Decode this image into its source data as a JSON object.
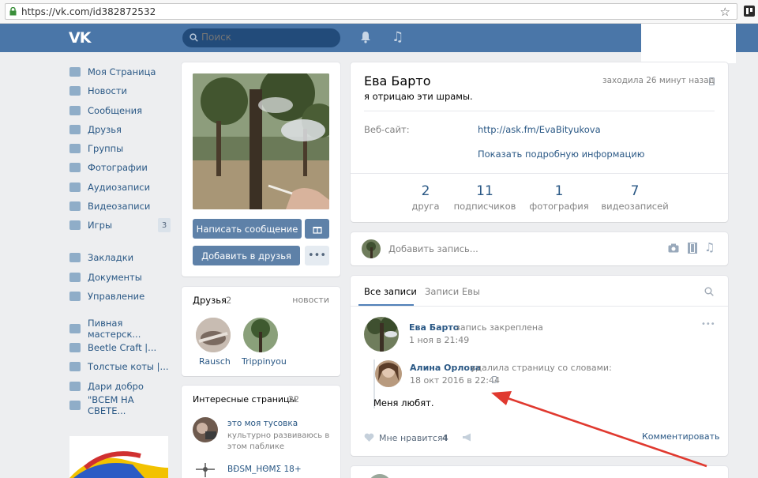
{
  "browser": {
    "url": "https://vk.com/id382872532"
  },
  "header": {
    "search_placeholder": "Поиск"
  },
  "menu": {
    "items": [
      {
        "label": "Моя Страница",
        "icon": "home-icon"
      },
      {
        "label": "Новости",
        "icon": "news-icon"
      },
      {
        "label": "Сообщения",
        "icon": "messages-icon"
      },
      {
        "label": "Друзья",
        "icon": "friends-icon"
      },
      {
        "label": "Группы",
        "icon": "groups-icon"
      },
      {
        "label": "Фотографии",
        "icon": "photos-icon"
      },
      {
        "label": "Аудиозаписи",
        "icon": "audio-icon"
      },
      {
        "label": "Видеозаписи",
        "icon": "video-icon"
      },
      {
        "label": "Игры",
        "icon": "games-icon",
        "badge": "3"
      }
    ],
    "items2": [
      {
        "label": "Закладки",
        "icon": "bookmarks-icon"
      },
      {
        "label": "Документы",
        "icon": "documents-icon"
      },
      {
        "label": "Управление",
        "icon": "manage-icon"
      }
    ],
    "communities": [
      {
        "label": "Пивная мастерск..."
      },
      {
        "label": "Beetle Craft |..."
      },
      {
        "label": "Толстые коты |..."
      },
      {
        "label": "Дари добро"
      },
      {
        "label": "\"ВСЕМ НА СВЕТЕ..."
      }
    ]
  },
  "profile_actions": {
    "message_button": "Написать сообщение",
    "add_friend_button": "Добавить в друзья"
  },
  "friends_block": {
    "title": "Друзья",
    "count": "2",
    "link": "новости",
    "friends": [
      {
        "name": "Rausch"
      },
      {
        "name": "Trippinyou"
      }
    ]
  },
  "interesting": {
    "title": "Интересные страницы",
    "count": "22",
    "pages": [
      {
        "name": "это моя тусовка",
        "desc": "культурно развиваюсь в этом паблике"
      },
      {
        "name": "ВĐSM_НΘМΣ 18+"
      }
    ]
  },
  "profile": {
    "name": "Ева Барто",
    "status": "я отрицаю эти шрамы.",
    "last_seen": "заходила 26 минут назад",
    "website_label": "Веб-сайт:",
    "website": "http://ask.fm/EvaBityukova",
    "more_info": "Показать подробную информацию",
    "stats": [
      {
        "num": "2",
        "label": "друга"
      },
      {
        "num": "11",
        "label": "подписчиков"
      },
      {
        "num": "1",
        "label": "фотография"
      },
      {
        "num": "7",
        "label": "видеозаписей"
      }
    ]
  },
  "composer": {
    "placeholder": "Добавить запись..."
  },
  "wall": {
    "tabs": [
      "Все записи",
      "Записи Евы"
    ],
    "post": {
      "author": "Ева Барто",
      "pinned": "запись закреплена",
      "date": "1 ноя в 21:49",
      "repost_author": "Алина Орлова",
      "repost_action": "удалила страницу со словами:",
      "repost_date": "18 окт 2016 в 22:44",
      "text": "Меня любят.",
      "like_label": "Мне нравится",
      "like_count": "4",
      "comment_label": "Комментировать"
    }
  },
  "annotation": {
    "arrow_color": "#e0392f"
  }
}
